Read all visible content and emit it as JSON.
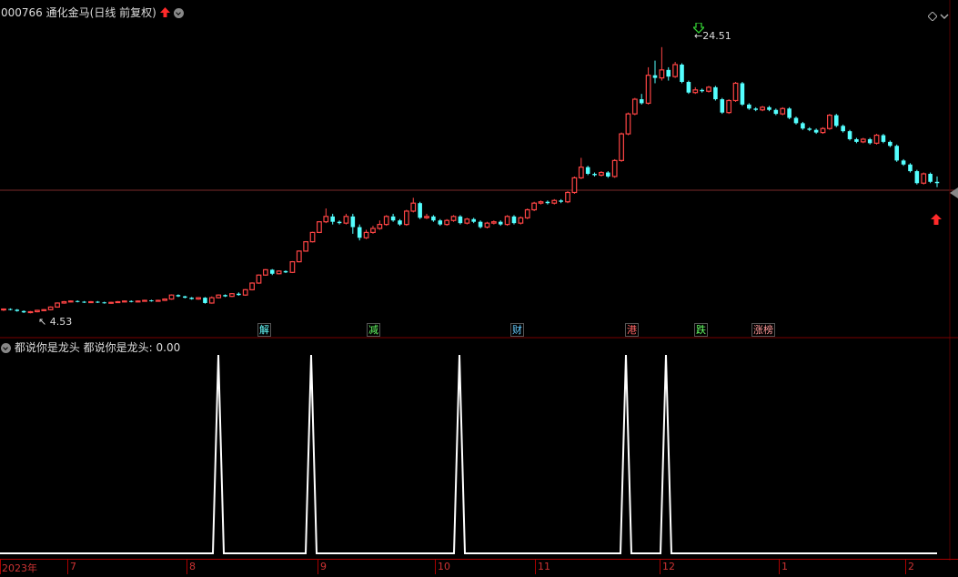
{
  "header": {
    "stock_code": "000766",
    "stock_name": "通化金马",
    "period_label": "(日线 前复权)"
  },
  "indicator": {
    "name": "都说你是龙头",
    "value_label": "都说你是龙头: 0.00"
  },
  "price_annotations": {
    "high": "24.51",
    "low": "4.53"
  },
  "events": [
    {
      "label": "解",
      "color": "#6ff"
    },
    {
      "label": "减",
      "color": "#6f6"
    },
    {
      "label": "财",
      "color": "#6cf"
    },
    {
      "label": "港",
      "color": "#f66"
    },
    {
      "label": "跌",
      "color": "#6f6"
    },
    {
      "label": "涨榜",
      "color": "#f99"
    }
  ],
  "time_axis": {
    "labels": [
      "2023年",
      "7",
      "8",
      "9",
      "10",
      "11",
      "12",
      "1",
      "2"
    ]
  },
  "colors": {
    "up": "#ff4545",
    "down": "#54ffff",
    "indicator_line": "#ffffff",
    "axis": "#aa0000"
  },
  "chart_data": {
    "type": "candlestick",
    "y_range": [
      4.0,
      26.0
    ],
    "candles": [
      [
        4.8,
        4.85,
        4.7,
        4.9
      ],
      [
        4.85,
        4.8,
        4.75,
        4.9
      ],
      [
        4.8,
        4.7,
        4.65,
        4.85
      ],
      [
        4.7,
        4.6,
        4.55,
        4.75
      ],
      [
        4.6,
        4.65,
        4.53,
        4.7
      ],
      [
        4.65,
        4.75,
        4.6,
        4.8
      ],
      [
        4.75,
        4.8,
        4.7,
        4.85
      ],
      [
        4.8,
        5.0,
        4.75,
        5.05
      ],
      [
        5.0,
        5.3,
        4.95,
        5.35
      ],
      [
        5.3,
        5.4,
        5.25,
        5.45
      ],
      [
        5.4,
        5.45,
        5.35,
        5.5
      ],
      [
        5.45,
        5.4,
        5.35,
        5.5
      ],
      [
        5.4,
        5.35,
        5.3,
        5.45
      ],
      [
        5.35,
        5.4,
        5.3,
        5.45
      ],
      [
        5.4,
        5.35,
        5.3,
        5.45
      ],
      [
        5.35,
        5.3,
        5.25,
        5.4
      ],
      [
        5.3,
        5.35,
        5.25,
        5.4
      ],
      [
        5.35,
        5.4,
        5.3,
        5.45
      ],
      [
        5.4,
        5.45,
        5.35,
        5.5
      ],
      [
        5.45,
        5.4,
        5.35,
        5.5
      ],
      [
        5.4,
        5.45,
        5.35,
        5.5
      ],
      [
        5.45,
        5.5,
        5.4,
        5.55
      ],
      [
        5.5,
        5.45,
        5.4,
        5.55
      ],
      [
        5.45,
        5.5,
        5.4,
        5.55
      ],
      [
        5.5,
        5.6,
        5.45,
        5.65
      ],
      [
        5.6,
        5.9,
        5.55,
        5.95
      ],
      [
        5.9,
        5.8,
        5.75,
        5.95
      ],
      [
        5.8,
        5.7,
        5.65,
        5.85
      ],
      [
        5.7,
        5.6,
        5.55,
        5.75
      ],
      [
        5.6,
        5.7,
        5.55,
        5.75
      ],
      [
        5.7,
        5.3,
        5.25,
        5.75
      ],
      [
        5.3,
        5.7,
        5.25,
        5.8
      ],
      [
        5.7,
        5.9,
        5.65,
        5.95
      ],
      [
        5.9,
        5.8,
        5.75,
        5.95
      ],
      [
        5.8,
        6.0,
        5.75,
        6.05
      ],
      [
        6.0,
        5.9,
        5.85,
        6.1
      ],
      [
        5.9,
        6.3,
        5.85,
        6.35
      ],
      [
        6.3,
        6.8,
        6.25,
        6.85
      ],
      [
        6.8,
        7.4,
        6.75,
        7.45
      ],
      [
        7.4,
        7.8,
        7.35,
        7.85
      ],
      [
        7.8,
        7.5,
        7.4,
        7.85
      ],
      [
        7.5,
        7.7,
        7.45,
        7.75
      ],
      [
        7.7,
        7.6,
        7.55,
        7.75
      ],
      [
        7.6,
        8.4,
        7.55,
        8.45
      ],
      [
        8.4,
        9.2,
        8.35,
        9.25
      ],
      [
        9.2,
        9.9,
        9.15,
        9.95
      ],
      [
        9.9,
        10.6,
        9.85,
        10.65
      ],
      [
        10.6,
        11.4,
        10.55,
        11.45
      ],
      [
        11.4,
        11.8,
        11.3,
        12.4
      ],
      [
        11.8,
        11.4,
        11.2,
        12.0
      ],
      [
        11.4,
        11.3,
        11.2,
        11.5
      ],
      [
        11.3,
        11.8,
        11.2,
        12.0
      ],
      [
        11.8,
        11.0,
        10.5,
        12.0
      ],
      [
        11.0,
        10.2,
        10.0,
        11.2
      ],
      [
        10.2,
        10.6,
        10.1,
        10.8
      ],
      [
        10.6,
        10.9,
        10.5,
        11.1
      ],
      [
        10.9,
        11.2,
        10.8,
        11.5
      ],
      [
        11.2,
        11.8,
        11.1,
        11.9
      ],
      [
        11.8,
        11.5,
        11.4,
        12.0
      ],
      [
        11.5,
        11.2,
        11.1,
        11.6
      ],
      [
        11.2,
        12.2,
        11.1,
        12.3
      ],
      [
        12.2,
        12.8,
        12.1,
        13.2
      ],
      [
        12.8,
        11.7,
        11.6,
        12.9
      ],
      [
        11.7,
        11.8,
        11.6,
        12.0
      ],
      [
        11.8,
        11.5,
        11.4,
        11.9
      ],
      [
        11.5,
        11.2,
        11.1,
        11.6
      ],
      [
        11.2,
        11.5,
        11.1,
        11.6
      ],
      [
        11.5,
        11.8,
        11.4,
        11.9
      ],
      [
        11.8,
        11.3,
        11.2,
        11.9
      ],
      [
        11.3,
        11.6,
        11.2,
        11.7
      ],
      [
        11.6,
        11.4,
        11.3,
        11.7
      ],
      [
        11.4,
        11.0,
        10.9,
        11.5
      ],
      [
        11.0,
        11.3,
        10.9,
        11.4
      ],
      [
        11.3,
        11.4,
        11.2,
        11.5
      ],
      [
        11.4,
        11.2,
        11.1,
        11.5
      ],
      [
        11.2,
        11.8,
        11.1,
        11.9
      ],
      [
        11.8,
        11.3,
        11.2,
        11.9
      ],
      [
        11.3,
        11.7,
        11.2,
        11.8
      ],
      [
        11.7,
        12.3,
        11.6,
        12.4
      ],
      [
        12.3,
        12.8,
        12.2,
        12.9
      ],
      [
        12.8,
        12.9,
        12.7,
        13.0
      ],
      [
        12.9,
        12.8,
        12.7,
        13.0
      ],
      [
        12.8,
        13.0,
        12.7,
        13.1
      ],
      [
        13.0,
        12.9,
        12.8,
        13.1
      ],
      [
        12.9,
        13.6,
        12.8,
        13.7
      ],
      [
        13.6,
        14.7,
        13.5,
        14.8
      ],
      [
        14.7,
        15.5,
        14.6,
        16.2
      ],
      [
        15.5,
        15.0,
        14.9,
        15.6
      ],
      [
        15.0,
        14.9,
        14.8,
        15.1
      ],
      [
        14.9,
        15.1,
        14.8,
        15.2
      ],
      [
        15.1,
        14.8,
        14.7,
        15.2
      ],
      [
        14.8,
        16.0,
        14.7,
        16.1
      ],
      [
        16.0,
        18.0,
        15.9,
        18.1
      ],
      [
        18.0,
        19.5,
        17.9,
        19.6
      ],
      [
        19.5,
        20.6,
        19.4,
        20.7
      ],
      [
        20.6,
        20.3,
        20.2,
        21.0
      ],
      [
        20.3,
        22.4,
        20.2,
        23.0
      ],
      [
        22.4,
        22.2,
        21.8,
        23.5
      ],
      [
        22.2,
        22.8,
        22.0,
        24.51
      ],
      [
        22.8,
        22.3,
        22.0,
        23.0
      ],
      [
        22.3,
        23.2,
        22.2,
        23.4
      ],
      [
        23.2,
        21.9,
        21.8,
        23.3
      ],
      [
        21.9,
        21.1,
        21.0,
        22.0
      ],
      [
        21.1,
        21.3,
        21.0,
        21.5
      ],
      [
        21.3,
        21.2,
        21.1,
        21.4
      ],
      [
        21.2,
        21.5,
        21.1,
        21.6
      ],
      [
        21.5,
        20.6,
        20.5,
        21.6
      ],
      [
        20.6,
        19.6,
        19.5,
        20.7
      ],
      [
        19.6,
        20.5,
        19.5,
        20.6
      ],
      [
        20.5,
        21.8,
        20.4,
        21.9
      ],
      [
        21.8,
        20.2,
        20.1,
        21.9
      ],
      [
        20.2,
        19.9,
        19.8,
        20.3
      ],
      [
        19.9,
        19.8,
        19.7,
        20.0
      ],
      [
        19.8,
        20.0,
        19.7,
        20.1
      ],
      [
        20.0,
        19.8,
        19.7,
        20.1
      ],
      [
        19.8,
        19.5,
        19.4,
        19.9
      ],
      [
        19.5,
        19.9,
        19.4,
        20.0
      ],
      [
        19.9,
        19.2,
        19.1,
        20.0
      ],
      [
        19.2,
        18.8,
        18.7,
        19.3
      ],
      [
        18.8,
        18.4,
        18.3,
        18.9
      ],
      [
        18.4,
        18.3,
        18.2,
        18.5
      ],
      [
        18.3,
        18.1,
        18.0,
        18.4
      ],
      [
        18.1,
        18.4,
        18.0,
        18.5
      ],
      [
        18.4,
        19.4,
        18.3,
        19.5
      ],
      [
        19.4,
        18.6,
        18.5,
        19.5
      ],
      [
        18.6,
        18.2,
        18.1,
        18.7
      ],
      [
        18.2,
        17.6,
        17.5,
        18.3
      ],
      [
        17.6,
        17.4,
        17.3,
        17.7
      ],
      [
        17.4,
        17.6,
        17.3,
        17.7
      ],
      [
        17.6,
        17.3,
        17.2,
        17.7
      ],
      [
        17.3,
        17.9,
        17.2,
        18.0
      ],
      [
        17.9,
        17.4,
        17.3,
        18.0
      ],
      [
        17.4,
        17.1,
        17.0,
        17.5
      ],
      [
        17.1,
        16.0,
        15.9,
        17.2
      ],
      [
        16.0,
        15.7,
        15.6,
        16.1
      ],
      [
        15.7,
        15.2,
        15.1,
        15.8
      ],
      [
        15.2,
        14.3,
        14.2,
        15.3
      ],
      [
        14.3,
        15.0,
        14.2,
        15.1
      ],
      [
        15.0,
        14.4,
        14.3,
        15.1
      ],
      [
        14.4,
        14.3,
        14.0,
        14.8
      ]
    ],
    "indicator": {
      "series_name": "都说你是龙头",
      "y_range": [
        0,
        1
      ],
      "spike_months": [
        "8",
        "9",
        "10",
        "11",
        "12"
      ]
    }
  }
}
